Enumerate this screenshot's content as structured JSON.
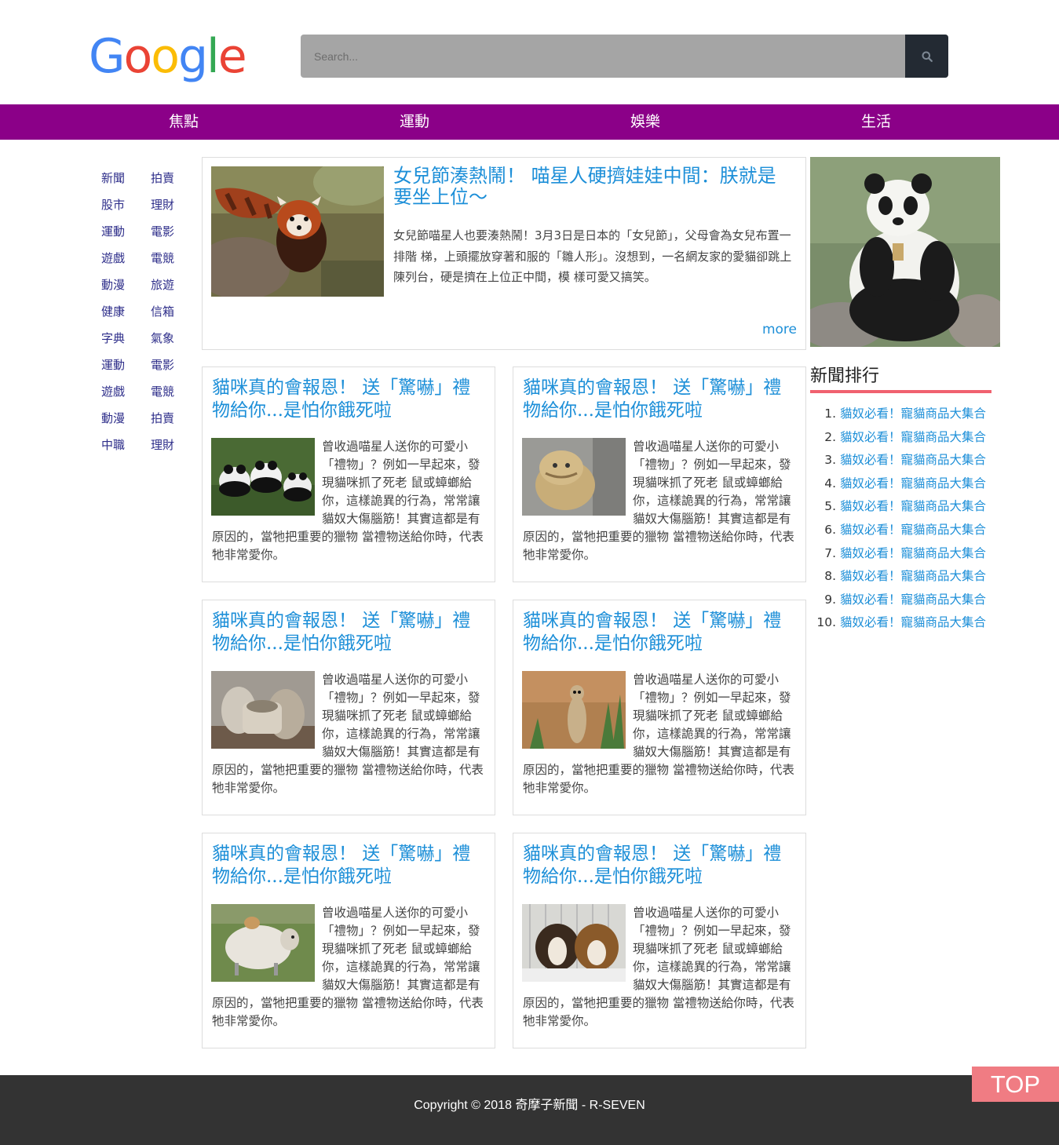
{
  "logo": {
    "letters": [
      "G",
      "o",
      "o",
      "g",
      "l",
      "e"
    ],
    "colors": [
      "#4285f4",
      "#ea4335",
      "#fbbc05",
      "#4285f4",
      "#34a853",
      "#ea4335"
    ]
  },
  "search": {
    "placeholder": "Search..."
  },
  "nav": {
    "items": [
      "焦點",
      "運動",
      "娛樂",
      "生活"
    ],
    "background": "#8b0088"
  },
  "sidebar": {
    "col1": [
      "新聞",
      "股市",
      "運動",
      "遊戲",
      "動漫",
      "健康",
      "字典",
      "運動",
      "遊戲",
      "動漫",
      "中職"
    ],
    "col2": [
      "拍賣",
      "理財",
      "電影",
      "電競",
      "旅遊",
      "信箱",
      "氣象",
      "電影",
      "電競",
      "拍賣",
      "理財"
    ]
  },
  "feature": {
    "title": "女兒節湊熱鬧！ 喵星人硬擠娃娃中間：朕就是要坐上位～",
    "text": "女兒節喵星人也要湊熱鬧！3月3日是日本的「女兒節」，父母會為女兒布置一排階 梯，上頭擺放穿著和服的「雛人形」。沒想到，一名網友家的愛貓卻跳上陳列台，硬是擠在上位正中間，模 樣可愛又搞笑。",
    "more": "more"
  },
  "cards": [
    {
      "title": "貓咪真的會報恩！ 送「驚嚇」禮物給你...是怕你餓死啦",
      "text": "曾收過喵星人送你的可愛小「禮物」？例如一早起來，發現貓咪抓了死老 鼠或蟑螂給你，這樣詭異的行為，常常讓貓奴大傷腦筋！其實這都是有原因的，當牠把重要的獵物 當禮物送給你時，代表牠非常愛你。",
      "image": "pandas"
    },
    {
      "title": "貓咪真的會報恩！ 送「驚嚇」禮物給你...是怕你餓死啦",
      "text": "曾收過喵星人送你的可愛小「禮物」？例如一早起來，發現貓咪抓了死老 鼠或蟑螂給你，這樣詭異的行為，常常讓貓奴大傷腦筋！其實這都是有原因的，當牠把重要的獵物 當禮物送給你時，代表牠非常愛你。",
      "image": "dog-statue"
    },
    {
      "title": "貓咪真的會報恩！ 送「驚嚇」禮物給你...是怕你餓死啦",
      "text": "曾收過喵星人送你的可愛小「禮物」？例如一早起來，發現貓咪抓了死老 鼠或蟑螂給你，這樣詭異的行為，常常讓貓奴大傷腦筋！其實這都是有原因的，當牠把重要的獵物 當禮物送給你時，代表牠非常愛你。",
      "image": "stone-figures"
    },
    {
      "title": "貓咪真的會報恩！ 送「驚嚇」禮物給你...是怕你餓死啦",
      "text": "曾收過喵星人送你的可愛小「禮物」？例如一早起來，發現貓咪抓了死老 鼠或蟑螂給你，這樣詭異的行為，常常讓貓奴大傷腦筋！其實這都是有原因的，當牠把重要的獵物 當禮物送給你時，代表牠非常愛你。",
      "image": "meerkat"
    },
    {
      "title": "貓咪真的會報恩！ 送「驚嚇」禮物給你...是怕你餓死啦",
      "text": "曾收過喵星人送你的可愛小「禮物」？例如一早起來，發現貓咪抓了死老 鼠或蟑螂給你，這樣詭異的行為，常常讓貓奴大傷腦筋！其實這都是有原因的，當牠把重要的獵物 當禮物送給你時，代表牠非常愛你。",
      "image": "sheep"
    },
    {
      "title": "貓咪真的會報恩！ 送「驚嚇」禮物給你...是怕你餓死啦",
      "text": "曾收過喵星人送你的可愛小「禮物」？例如一早起來，發現貓咪抓了死老 鼠或蟑螂給你，這樣詭異的行為，常常讓貓奴大傷腦筋！其實這都是有原因的，當牠把重要的獵物 當禮物送給你時，代表牠非常愛你。",
      "image": "puppies"
    }
  ],
  "ranking": {
    "title": "新聞排行",
    "items": [
      {
        "num": "1.",
        "label": "貓奴必看！寵貓商品大集合"
      },
      {
        "num": "2.",
        "label": "貓奴必看！寵貓商品大集合"
      },
      {
        "num": "3.",
        "label": "貓奴必看！寵貓商品大集合"
      },
      {
        "num": "4.",
        "label": "貓奴必看！寵貓商品大集合"
      },
      {
        "num": "5.",
        "label": "貓奴必看！寵貓商品大集合"
      },
      {
        "num": "6.",
        "label": "貓奴必看！寵貓商品大集合"
      },
      {
        "num": "7.",
        "label": "貓奴必看！寵貓商品大集合"
      },
      {
        "num": "8.",
        "label": "貓奴必看！寵貓商品大集合"
      },
      {
        "num": "9.",
        "label": "貓奴必看！寵貓商品大集合"
      },
      {
        "num": "10.",
        "label": "貓奴必看！寵貓商品大集合"
      }
    ]
  },
  "footer": {
    "copyright": "Copyright © 2018 奇摩子新聞 - R-SEVEN"
  },
  "top_button": {
    "label": "TOP"
  },
  "colors": {
    "link": "#1d8fd8",
    "accent": "#f0616f",
    "top_button": "#f07c83",
    "footer": "#333333"
  }
}
